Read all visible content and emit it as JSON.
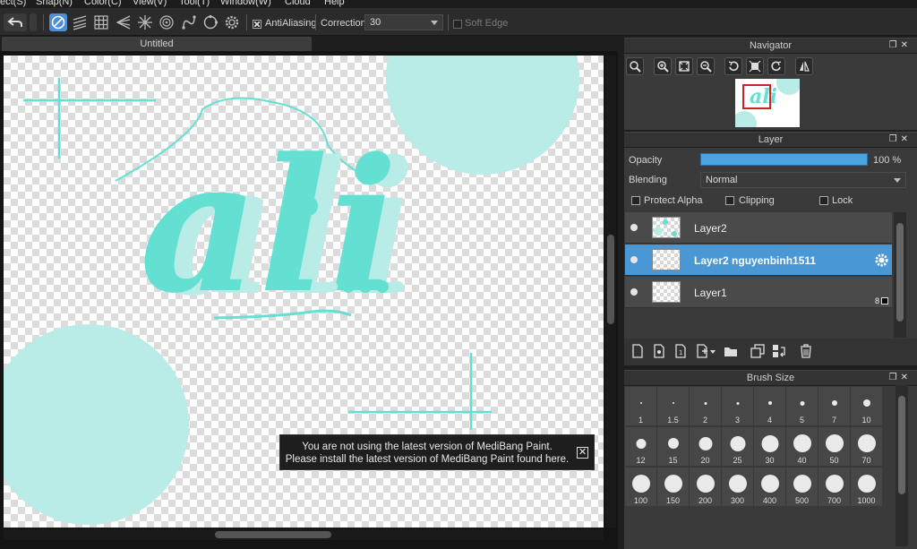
{
  "menu": [
    "ect(S)",
    "Snap(N)",
    "Color(C)",
    "View(V)",
    "Tool(T)",
    "Window(W)",
    "Cloud",
    "Help"
  ],
  "toolbar": {
    "antialiasing_label": "AntiAliasing",
    "antialiasing_checked": true,
    "correction_label": "Correction",
    "correction_value": "30",
    "soft_edge_label": "Soft Edge",
    "soft_edge_checked": false
  },
  "document": {
    "tab_title": "Untitled",
    "canvas_text": "ali",
    "notice_line1": "You are not using the latest version of MediBang Paint.",
    "notice_line2": "Please install the latest version of MediBang Paint found here.",
    "notice_close": "✕"
  },
  "navigator": {
    "title": "Navigator"
  },
  "layer_panel": {
    "title": "Layer",
    "opacity_label": "Opacity",
    "opacity_value": "100 %",
    "opacity_fraction": 1.0,
    "blending_label": "Blending",
    "blending_value": "Normal",
    "protect_alpha_label": "Protect Alpha",
    "clipping_label": "Clipping",
    "lock_label": "Lock",
    "layers": [
      {
        "name": "Layer2",
        "selected": false
      },
      {
        "name": "Layer2 nguyenbinh1511",
        "selected": true
      },
      {
        "name": "Layer1",
        "selected": false
      }
    ],
    "layer1_badge": "8"
  },
  "brush_size": {
    "title": "Brush Size",
    "sizes": [
      "1",
      "1.5",
      "2",
      "3",
      "4",
      "5",
      "7",
      "10",
      "12",
      "15",
      "20",
      "25",
      "30",
      "40",
      "50",
      "70",
      "100",
      "150",
      "200",
      "300",
      "400",
      "500",
      "700",
      "1000"
    ]
  },
  "colors": {
    "accent": "#4c8fd6",
    "art": "#64e0d2",
    "art_light": "#b9ece6",
    "panel": "#3a3a3a"
  }
}
